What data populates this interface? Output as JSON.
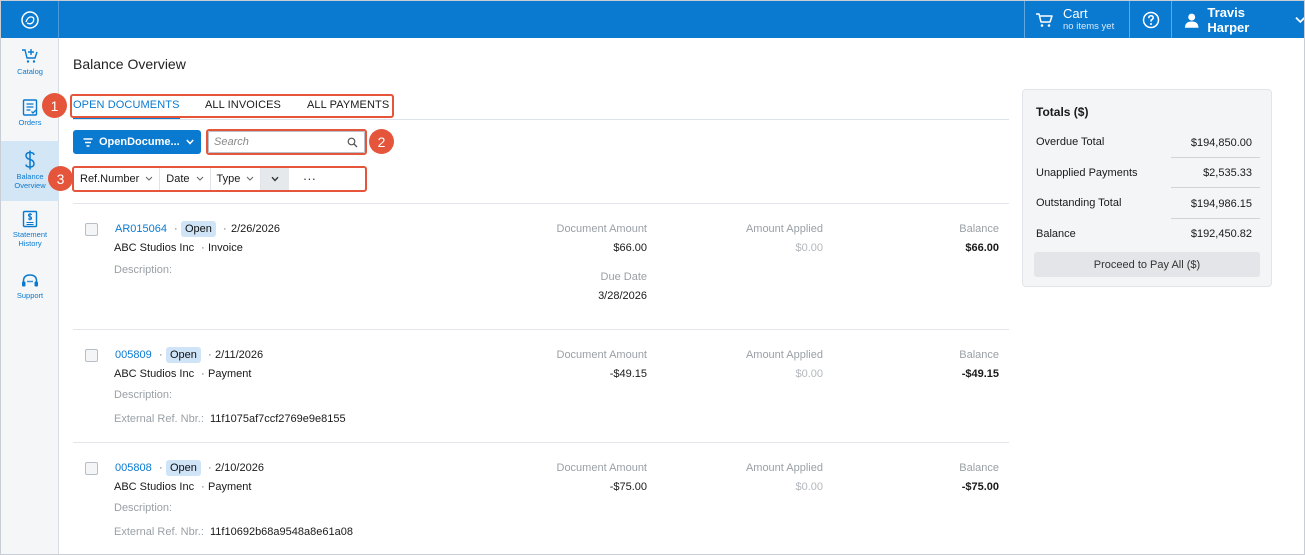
{
  "header": {
    "cart_title": "Cart",
    "cart_sub": "no items yet",
    "user_name": "Travis Harper"
  },
  "sidebar": {
    "items": [
      {
        "label": "Catalog",
        "icon": "cart-plus-icon"
      },
      {
        "label": "Orders",
        "icon": "clipboard-icon"
      },
      {
        "label": "Balance Overview",
        "icon": "dollar-icon"
      },
      {
        "label": "Statement History",
        "icon": "statement-icon"
      },
      {
        "label": "Support",
        "icon": "headset-icon"
      }
    ]
  },
  "page": {
    "title": "Balance Overview"
  },
  "tabs": [
    {
      "label": "OPEN DOCUMENTS",
      "active": true
    },
    {
      "label": "ALL INVOICES",
      "active": false
    },
    {
      "label": "ALL PAYMENTS",
      "active": false
    }
  ],
  "toolbar": {
    "filter_label": "OpenDocume...",
    "search_placeholder": "Search",
    "sort_fields": [
      "Ref.Number",
      "Date",
      "Type"
    ],
    "more_label": "···"
  },
  "callouts": [
    "1",
    "2",
    "3"
  ],
  "columns": {
    "document_amount": "Document Amount",
    "amount_applied": "Amount Applied",
    "balance": "Balance",
    "due_date": "Due Date",
    "description": "Description:",
    "external_ref": "External Ref. Nbr.:"
  },
  "documents": [
    {
      "ref": "AR015064",
      "status": "Open",
      "date": "2/26/2026",
      "customer": "ABC Studios Inc",
      "type": "Invoice",
      "document_amount": "$66.00",
      "amount_applied": "$0.00",
      "balance": "$66.00",
      "due_date": "3/28/2026"
    },
    {
      "ref": "005809",
      "status": "Open",
      "date": "2/11/2026",
      "customer": "ABC Studios Inc",
      "type": "Payment",
      "document_amount": "-$49.15",
      "amount_applied": "$0.00",
      "balance": "-$49.15",
      "external_ref": "11f1075af7ccf2769e9e8155"
    },
    {
      "ref": "005808",
      "status": "Open",
      "date": "2/10/2026",
      "customer": "ABC Studios Inc",
      "type": "Payment",
      "document_amount": "-$75.00",
      "amount_applied": "$0.00",
      "balance": "-$75.00",
      "external_ref": "11f10692b68a9548a8e61a08"
    }
  ],
  "totals": {
    "title": "Totals ($)",
    "rows": [
      {
        "label": "Overdue Total",
        "value": "$194,850.00"
      },
      {
        "label": "Unapplied Payments",
        "value": "$2,535.33"
      },
      {
        "label": "Outstanding Total",
        "value": "$194,986.15"
      },
      {
        "label": "Balance",
        "value": "$192,450.82"
      }
    ],
    "proceed_label": "Proceed to Pay All ($)"
  },
  "colors": {
    "brand": "#0a7ad1",
    "callout": "#e4553b",
    "status_bg": "#cfe4f7"
  }
}
